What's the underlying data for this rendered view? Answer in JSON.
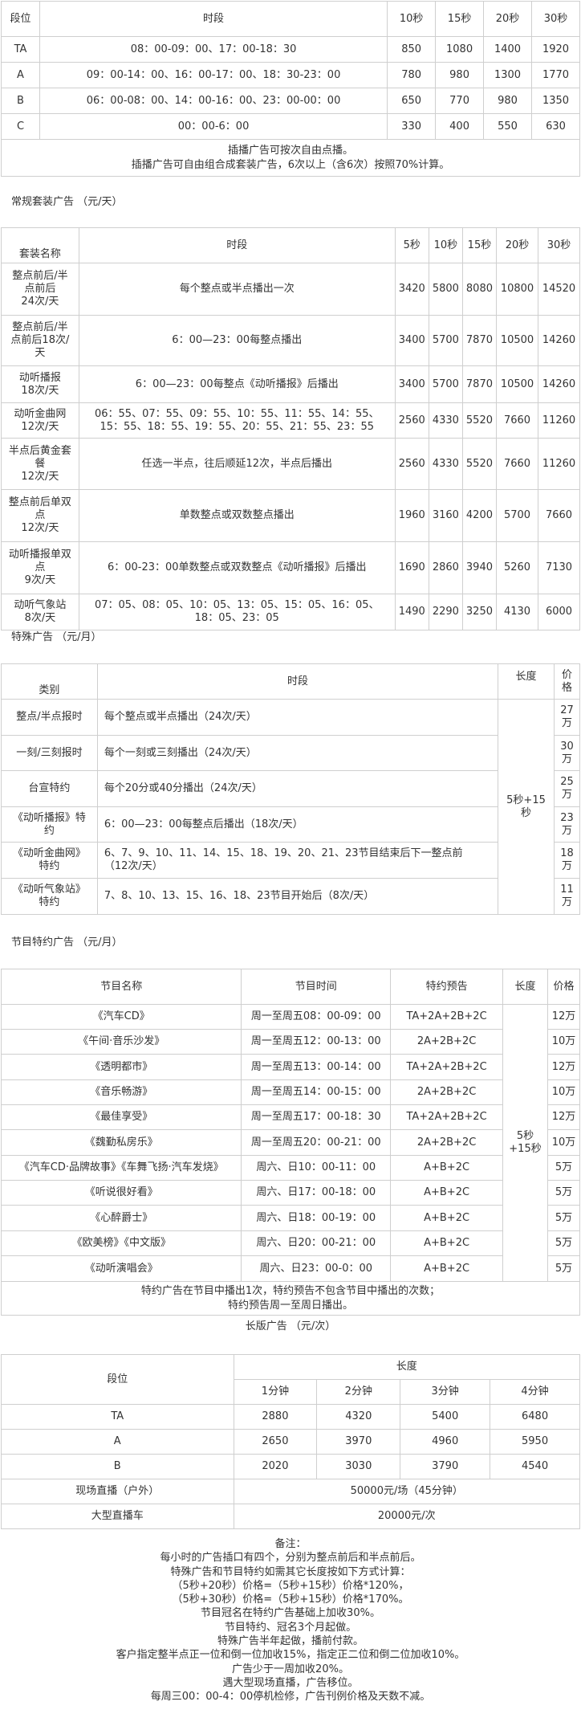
{
  "table1": {
    "headers": [
      "段位",
      "时段",
      "10秒",
      "15秒",
      "20秒",
      "30秒"
    ],
    "rows": [
      [
        "TA",
        "08：00-09：00、17：00-18：30",
        "850",
        "1080",
        "1400",
        "1920"
      ],
      [
        "A",
        "09：00-14：00、16：00-17：00、18：30-23：00",
        "780",
        "980",
        "1300",
        "1770"
      ],
      [
        "B",
        "06：00-08：00、14：00-16：00、23：00-00：00",
        "650",
        "770",
        "980",
        "1350"
      ],
      [
        "C",
        "00：00-6：00",
        "330",
        "400",
        "550",
        "630"
      ]
    ],
    "notes": [
      "插播广告可按次自由点播。",
      "插播广告可自由组合成套装广告，6次以上（含6次）按照70%计算。"
    ]
  },
  "section_package": "常规套装广告 （元/天）",
  "table2": {
    "headers": [
      "套装名称",
      "时段",
      "5秒",
      "10秒",
      "15秒",
      "20秒",
      "30秒"
    ],
    "rows": [
      {
        "name": [
          "整点前后/半",
          "点前后",
          "24次/天"
        ],
        "time": [
          "每个整点或半点播出一次"
        ],
        "v": [
          "3420",
          "5800",
          "8080",
          "10800",
          "14520"
        ]
      },
      {
        "name": [
          "整点前后/半",
          "点前后18次/",
          "天"
        ],
        "time": [
          "6：00—23：00每整点播出"
        ],
        "v": [
          "3400",
          "5700",
          "7870",
          "10500",
          "14260"
        ]
      },
      {
        "name": [
          "动听播报",
          "18次/天"
        ],
        "time": [
          "6：00—23：00每整点《动听播报》后播出"
        ],
        "v": [
          "3400",
          "5700",
          "7870",
          "10500",
          "14260"
        ]
      },
      {
        "name": [
          "动听金曲网",
          "12次/天"
        ],
        "time": [
          "06：55、07：55、09：55、10：55、11：55、14：55、",
          "15：55、18：55、19：55、20：55、21：55、23：55"
        ],
        "v": [
          "2560",
          "4330",
          "5520",
          "7660",
          "11260"
        ]
      },
      {
        "name": [
          "半点后黄金套",
          "餐",
          "12次/天"
        ],
        "time": [
          "任选一半点，往后顺延12次，半点后播出"
        ],
        "v": [
          "2560",
          "4330",
          "5520",
          "7660",
          "11260"
        ]
      },
      {
        "name": [
          "整点前后单双",
          "点",
          "12次/天"
        ],
        "time": [
          "单数整点或双数整点播出"
        ],
        "v": [
          "1960",
          "3160",
          "4200",
          "5700",
          "7660"
        ]
      },
      {
        "name": [
          "动听播报单双",
          "点",
          "9次/天"
        ],
        "time": [
          "6：00-23：00单数整点或双数整点《动听播报》后播出"
        ],
        "v": [
          "1690",
          "2860",
          "3940",
          "5260",
          "7130"
        ]
      },
      {
        "name": [
          "动听气象站",
          "8次/天"
        ],
        "time": [
          "07：05、08：05、10：05、13：05、15：05、16：05、",
          "18：05、23：05"
        ],
        "v": [
          "1490",
          "2290",
          "3250",
          "4130",
          "6000"
        ]
      }
    ]
  },
  "section_special": "特殊广告 （元/月）",
  "table3": {
    "headers": [
      "类别",
      "时段",
      "长度",
      "价",
      "格"
    ],
    "length": [
      "5秒+15",
      "秒"
    ],
    "rows": [
      {
        "cat": [
          "整点/半点报时"
        ],
        "time": [
          "每个整点或半点播出（24次/天）"
        ],
        "price": [
          "27",
          "万"
        ]
      },
      {
        "cat": [
          "一刻/三刻报时"
        ],
        "time": [
          "每个一刻或三刻播出（24次/天）"
        ],
        "price": [
          "30",
          "万"
        ]
      },
      {
        "cat": [
          "台宣特约"
        ],
        "time": [
          "每个20分或40分播出（24次/天）"
        ],
        "price": [
          "25",
          "万"
        ]
      },
      {
        "cat": [
          "《动听播报》特",
          "约"
        ],
        "time": [
          "6：00—23：00每整点后播出（18次/天）"
        ],
        "price": [
          "23",
          "万"
        ]
      },
      {
        "cat": [
          "《动听金曲网》",
          "特约"
        ],
        "time": [
          "6、7、9、10、11、14、15、18、19、20、21、23节目结束后下一整点前",
          "（12次/天）"
        ],
        "price": [
          "18",
          "万"
        ]
      },
      {
        "cat": [
          "《动听气象站》",
          "特约"
        ],
        "time": [
          "7、8、10、13、15、16、18、23节目开始后（8次/天）"
        ],
        "price": [
          "11",
          "万"
        ]
      }
    ]
  },
  "section_program": "节目特约广告 （元/月）",
  "table4": {
    "headers": [
      "节目名称",
      "节目时间",
      "特约预告",
      "长度",
      "价格"
    ],
    "length": "5秒+15秒",
    "rows": [
      [
        "《汽车CD》",
        "周一至周五08：00-09：00",
        "TA+2A+2B+2C",
        "12万"
      ],
      [
        "《午间·音乐沙发》",
        "周一至周五12：00-13：00",
        "2A+2B+2C",
        "10万"
      ],
      [
        "《透明都市》",
        "周一至周五13：00-14：00",
        "TA+2A+2B+2C",
        "12万"
      ],
      [
        "《音乐畅游》",
        "周一至周五14：00-15：00",
        "2A+2B+2C",
        "10万"
      ],
      [
        "《最佳享受》",
        "周一至周五17：00-18：30",
        "TA+2A+2B+2C",
        "12万"
      ],
      [
        "《魏勤私房乐》",
        "周一至周五20：00-21：00",
        "2A+2B+2C",
        "10万"
      ],
      [
        "《汽车CD·品牌故事》《车舞飞扬·汽车发烧》",
        "周六、日10：00-11：00",
        "A+B+2C",
        "5万"
      ],
      [
        "《听说很好看》",
        "周六、日17：00-18：00",
        "A+B+2C",
        "5万"
      ],
      [
        "《心醉爵士》",
        "周六、日18：00-19：00",
        "A+B+2C",
        "5万"
      ],
      [
        "《欧美榜》《中文版》",
        "周六、日20：00-21：00",
        "A+B+2C",
        "5万"
      ],
      [
        "《动听演唱会》",
        "周六、日23：00-0：00",
        "A+B+2C",
        "5万"
      ]
    ],
    "notes": [
      "特约广告在节目中播出1次，特约预告不包含节目中播出的次数；",
      "特约预告周一至周日播出。"
    ]
  },
  "section_long": "长版广告 （元/次）",
  "table5": {
    "headers": [
      "段位",
      "长度",
      "1分钟",
      "2分钟",
      "3分钟",
      "4分钟"
    ],
    "rows": [
      [
        "TA",
        "2880",
        "4320",
        "5400",
        "6480"
      ],
      [
        "A",
        "2650",
        "3970",
        "4960",
        "5950"
      ],
      [
        "B",
        "2020",
        "3030",
        "3790",
        "4540"
      ]
    ],
    "extra": [
      [
        "现场直播（户外）",
        "50000元/场（45分钟）"
      ],
      [
        "大型直播车",
        "20000元/次"
      ]
    ]
  },
  "notes": [
    "备注：",
    "每小时的广告插口有四个，分别为整点前后和半点前后。",
    "特殊广告和节目特约如需其它长度按如下方式计算：",
    "（5秒+20秒）价格=（5秒+15秒）价格*120%，",
    "（5秒+30秒）价格=（5秒+15秒）价格*170%。",
    "节目冠名在特约广告基础上加收30%。",
    "节目特约、冠名3个月起做。",
    "特殊广告半年起做，播前付款。",
    "客户指定整半点正一位和倒一位加收15%，指定正二位和倒二位加收10%。",
    "广告少于一周加收20%。",
    "遇大型现场直播，广告移位。",
    "每周三00：00-4：00停机检修，广告刊例价格及天数不减。"
  ]
}
